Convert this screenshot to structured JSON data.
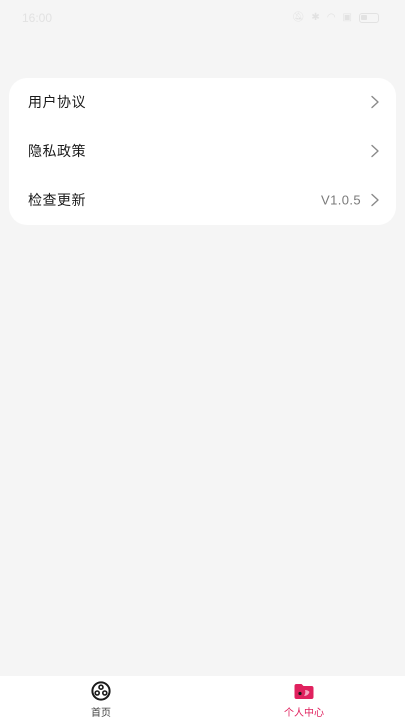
{
  "status_bar": {
    "time": "16:00",
    "icons": [
      "mute-icon",
      "bluetooth-icon",
      "wifi-icon",
      "sim-icon",
      "battery-icon"
    ]
  },
  "settings": {
    "items": [
      {
        "label": "用户协议",
        "value": "",
        "icon": "chevron-right-icon"
      },
      {
        "label": "隐私政策",
        "value": "",
        "icon": "chevron-right-icon"
      },
      {
        "label": "检查更新",
        "value": "V1.0.5",
        "icon": "chevron-right-icon"
      }
    ]
  },
  "bottom_nav": {
    "items": [
      {
        "label": "首页",
        "icon": "film-reel-icon",
        "active": false
      },
      {
        "label": "个人中心",
        "icon": "profile-folder-icon",
        "active": true
      }
    ]
  },
  "colors": {
    "background": "#f5f5f5",
    "card": "#ffffff",
    "accent": "#e0215e",
    "accent_light": "#f5a5c0",
    "text_primary": "#1a1a1a",
    "text_secondary": "#7a7a7a"
  }
}
